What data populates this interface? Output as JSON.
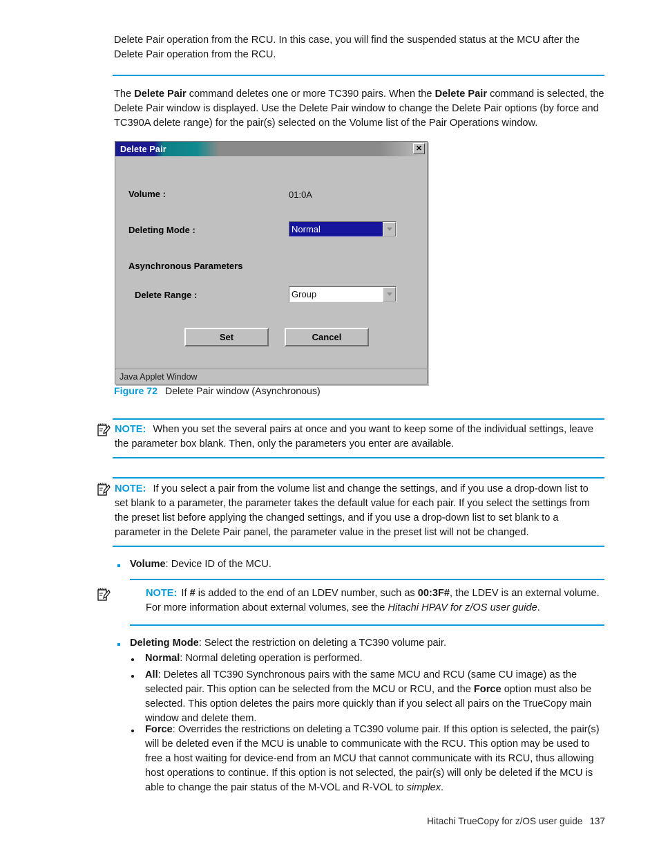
{
  "page": {
    "intro_paragraph": "Delete Pair operation from the RCU. In this case, you will find the suspended status at the MCU after the Delete Pair operation from the RCU.",
    "footer_text": "Hitachi TrueCopy for z/OS user guide",
    "page_number": "137"
  },
  "command_paragraph": {
    "part1": "The ",
    "bold1": "Delete Pair",
    "part2": " command deletes one or more TC390 pairs. When the ",
    "bold2": "Delete Pair",
    "part3": " command is selected, the Delete Pair window is displayed. Use the Delete Pair window to change the Delete Pair options (by force and TC390A delete range) for the pair(s) selected on the Volume list of the Pair Operations window."
  },
  "dialog": {
    "title": "Delete Pair",
    "close_label": "✕",
    "volume_label": "Volume :",
    "volume_value": "01:0A",
    "deleting_mode_label": "Deleting Mode :",
    "deleting_mode_value": "Normal",
    "async_heading": "Asynchronous Parameters",
    "delete_range_label": "Delete Range :",
    "delete_range_value": "Group",
    "set_button": "Set",
    "cancel_button": "Cancel",
    "statusbar": "Java Applet Window",
    "colors": {
      "titlebar_start": "#1b1b8f",
      "titlebar_mid": "#0f8a8e",
      "titlebar_end": "#8a8a8a",
      "face": "#c0c0c0",
      "selection": "#16169c"
    }
  },
  "caption": {
    "figure_number": "Figure 72",
    "figure_title": "Delete Pair window (Asynchronous)"
  },
  "notes": [
    {
      "label": "NOTE:",
      "icon": "note-pencil-icon",
      "text": "When you set the several pairs at once and you want to keep some of the individual settings, leave the parameter box blank. Then, only the parameters you enter are available."
    },
    {
      "label": "NOTE:",
      "icon": "note-pencil-icon",
      "text": "If you select a pair from the volume list and change the settings, and if you use a drop-down list to set blank to a parameter, the parameter takes the default value for each pair. If you select the settings from the preset list before applying the changed settings, and if you use a drop-down list to set blank to a parameter in the Delete Pair panel, the parameter value in the preset list will not be changed."
    }
  ],
  "volume_bullet": {
    "term": "Volume",
    "text": ": Device ID of the MCU."
  },
  "ldev_note": {
    "label": "NOTE:",
    "icon": "note-pencil-icon",
    "p1": "If ",
    "b1": "#",
    "p2": " is added to the end of an LDEV number, such as ",
    "b2": "00:3F#",
    "p3": ", the LDEV is an external volume. For more information about external volumes, see the ",
    "i1": "Hitachi HPAV for z/OS user guide",
    "p4": "."
  },
  "deleting_mode_bullet": {
    "term": "Deleting Mode",
    "text": ": Select the restriction on deleting a TC390 volume pair."
  },
  "sub_bullets": [
    {
      "term": "Normal",
      "text": ": Normal deleting operation is performed."
    },
    {
      "term": "All",
      "p1": ": Deletes all TC390 Synchronous pairs with the same MCU and RCU (same CU image) as the selected pair. This option can be selected from the MCU or RCU, and the ",
      "b1": "Force",
      "p2": " option must also be selected. This option deletes the pairs more quickly than if you select all pairs on the TrueCopy main window and delete them."
    },
    {
      "term": "Force",
      "p1": ": Overrides the restrictions on deleting a TC390 volume pair. If this option is selected, the pair(s) will be deleted even if the MCU is unable to communicate with the RCU. This option may be used to free a host waiting for device-end from an MCU that cannot communicate with its RCU, thus allowing host operations to continue. If this option is not selected, the pair(s) will only be deleted if the MCU is able to change the pair status of the M-VOL and R-VOL to ",
      "i1": "simplex",
      "p2": "."
    }
  ]
}
